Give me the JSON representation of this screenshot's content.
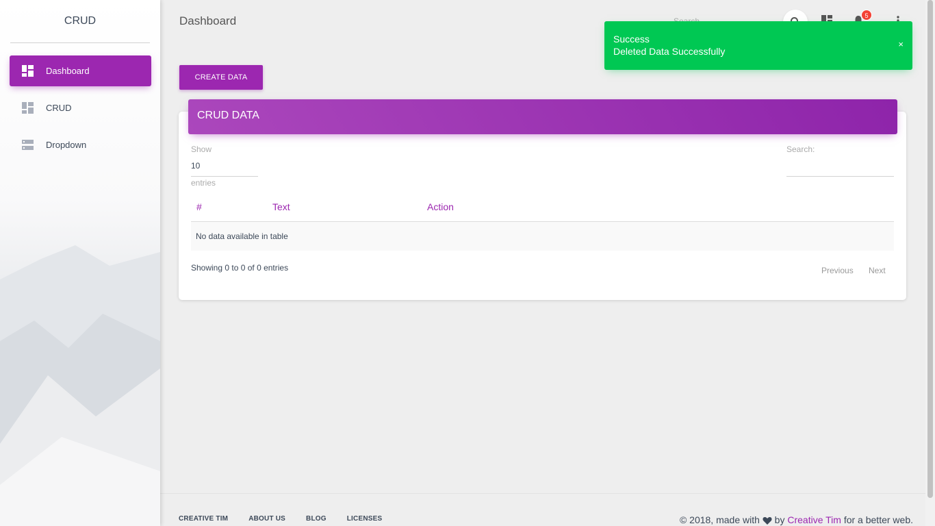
{
  "sidebar": {
    "brand": "CRUD",
    "items": [
      {
        "label": "Dashboard",
        "icon": "dashboard-icon",
        "active": true
      },
      {
        "label": "CRUD",
        "icon": "dashboard-icon",
        "active": false
      },
      {
        "label": "Dropdown",
        "icon": "dns-icon",
        "active": false
      }
    ]
  },
  "header": {
    "title": "Dashboard",
    "search_placeholder": "Search",
    "notification_count": "5"
  },
  "toolbar": {
    "create_label": "CREATE DATA"
  },
  "card": {
    "title": "CRUD DATA",
    "show_label": "Show",
    "length_value": "10",
    "entries_label": "entries",
    "search_label": "Search:",
    "columns": [
      "#",
      "Text",
      "Action"
    ],
    "empty_message": "No data available in table",
    "info": "Showing 0 to 0 of 0 entries",
    "prev_label": "Previous",
    "next_label": "Next"
  },
  "notification": {
    "title": "Success",
    "message": "Deleted Data Successfully",
    "close": "×"
  },
  "footer": {
    "links": [
      "CREATIVE TIM",
      "ABOUT US",
      "BLOG",
      "LICENSES"
    ],
    "copy_prefix": "© 2018, made with",
    "copy_by": "by",
    "copy_link": "Creative Tim",
    "copy_suffix": "for a better web."
  },
  "colors": {
    "primary": "#9c27b0",
    "success": "#00c853",
    "badge": "#f44336"
  }
}
